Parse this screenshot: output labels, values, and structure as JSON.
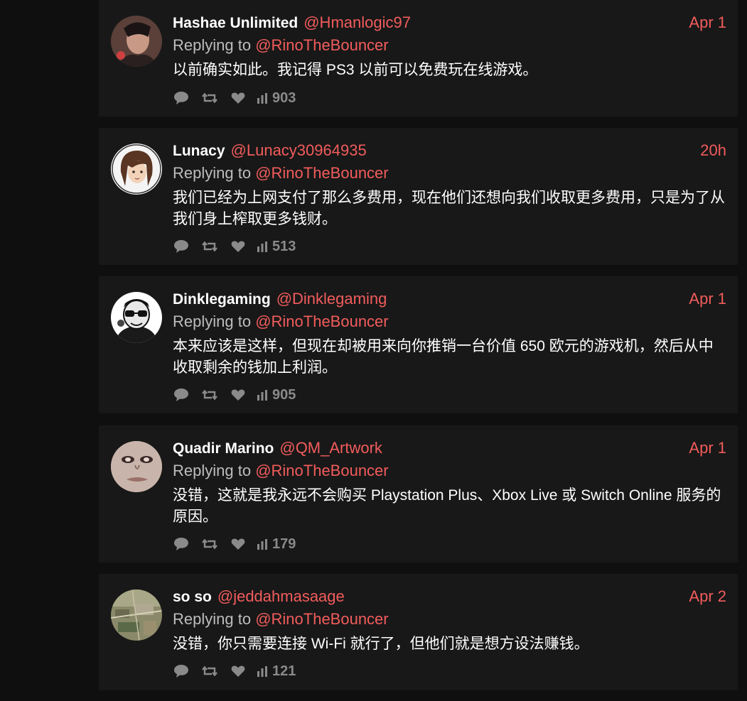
{
  "accent_color": "#f25c5c",
  "background_color": "#0f0f0f",
  "card_color": "#181818",
  "replies": [
    {
      "name": "Hashae Unlimited",
      "handle": "@Hmanlogic97",
      "time": "Apr 1",
      "replying_prefix": "Replying to ",
      "replying_to": "@RinoTheBouncer",
      "text": "以前确实如此。我记得 PS3 以前可以免费玩在线游戏。",
      "views": "903",
      "avatar": "dark-haired-man-avatar"
    },
    {
      "name": "Lunacy",
      "handle": "@Lunacy30964935",
      "time": "20h",
      "replying_prefix": "Replying to ",
      "replying_to": "@RinoTheBouncer",
      "text": "我们已经为上网支付了那么多费用，现在他们还想向我们收取更多费用，只是为了从我们身上榨取更多钱财。",
      "views": "513",
      "avatar": "anime-girl-avatar"
    },
    {
      "name": "Dinklegaming",
      "handle": "@Dinklegaming",
      "time": "Apr 1",
      "replying_prefix": "Replying to ",
      "replying_to": "@RinoTheBouncer",
      "text": "本来应该是这样，但现在却被用来向你推销一台价值 650 欧元的游戏机，然后从中收取剩余的钱加上利润。",
      "views": "905",
      "avatar": "cartoon-sunglasses-avatar"
    },
    {
      "name": "Quadir Marino",
      "handle": "@QM_Artwork",
      "time": "Apr 1",
      "replying_prefix": "Replying to ",
      "replying_to": "@RinoTheBouncer",
      "text": "没错，这就是我永远不会购买 Playstation Plus、Xbox Live 或 Switch Online 服务的原因。",
      "views": "179",
      "avatar": "face-closeup-avatar"
    },
    {
      "name": "so so",
      "handle": "@jeddahmasaage",
      "time": "Apr 2",
      "replying_prefix": "Replying to ",
      "replying_to": "@RinoTheBouncer",
      "text": "没错，你只需要连接 Wi-Fi 就行了，但他们就是想方设法赚钱。",
      "views": "121",
      "avatar": "aerial-city-avatar"
    }
  ]
}
